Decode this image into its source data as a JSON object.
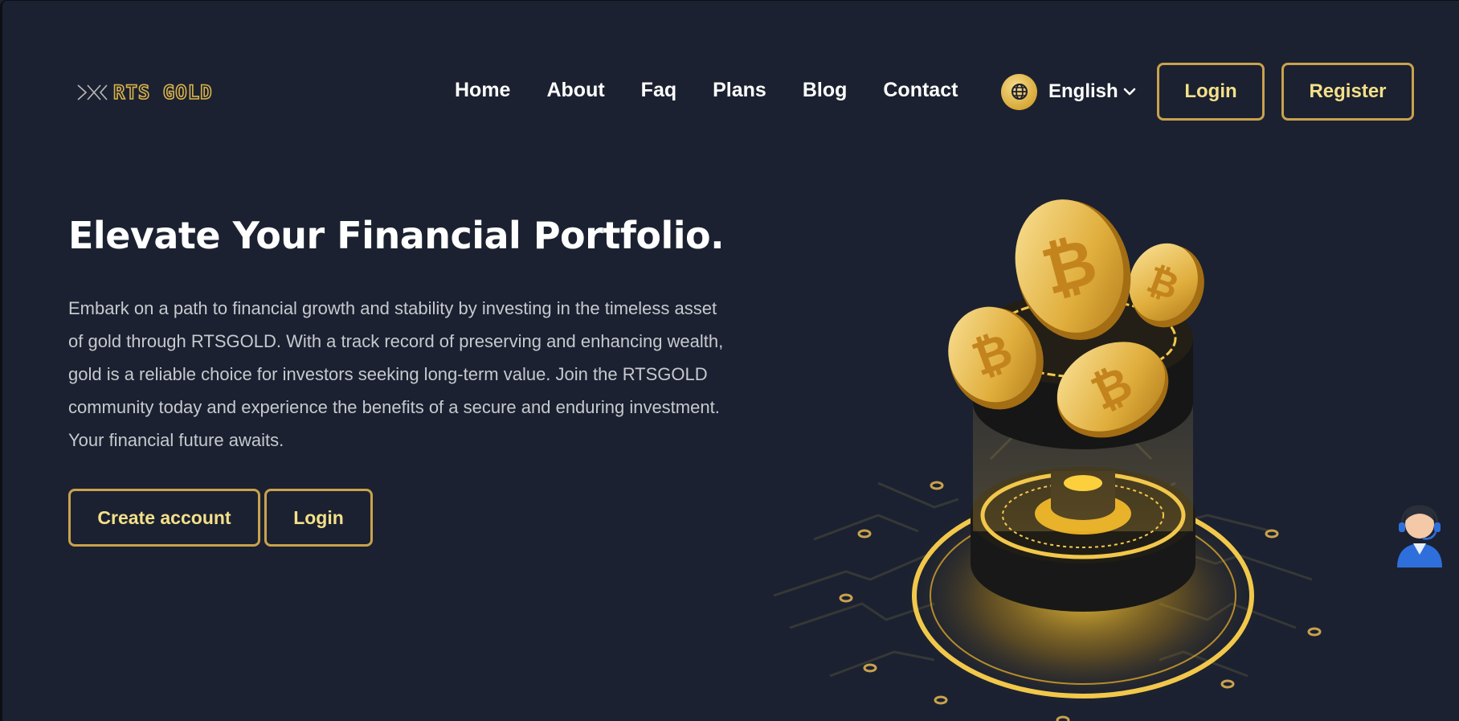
{
  "brand": {
    "logo_text": "RTS GOLD"
  },
  "nav": {
    "items": [
      {
        "label": "Home"
      },
      {
        "label": "About"
      },
      {
        "label": "Faq"
      },
      {
        "label": "Plans"
      },
      {
        "label": "Blog"
      },
      {
        "label": "Contact"
      }
    ]
  },
  "language": {
    "selected": "English",
    "icon": "globe-icon"
  },
  "header_buttons": {
    "login": "Login",
    "register": "Register"
  },
  "hero": {
    "title": "Elevate Your Financial Portfolio.",
    "description": "Embark on a path to financial growth and stability by investing in the timeless asset of gold through RTSGOLD. With a track record of preserving and enhancing wealth, gold is a reliable choice for investors seeking long-term value. Join the RTSGOLD community today and experience the benefits of a secure and enduring investment. Your financial future awaits.",
    "create_account": "Create account",
    "login": "Login"
  },
  "colors": {
    "background": "#1b2130",
    "accent_gold": "#c9a24e",
    "button_text": "#f3e08a",
    "body_text": "#c7c9cf"
  },
  "icons": {
    "illustration": "bitcoin-coins-illustration",
    "support": "support-agent-icon"
  }
}
